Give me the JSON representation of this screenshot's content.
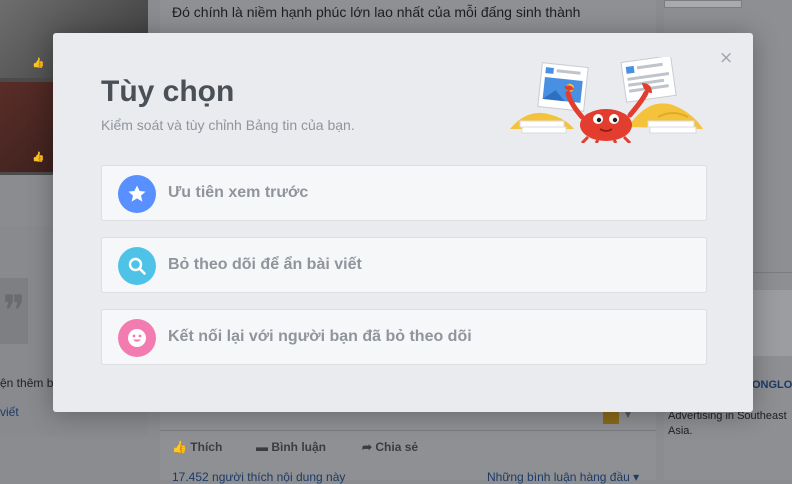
{
  "background": {
    "post_text": "Đó chính là niềm hạnh phúc lớn lao nhất của mỗi đấng sinh thành",
    "left_text_1": "ện thêm bạ",
    "left_text_2": "viết",
    "actions": {
      "like": "Thích",
      "comment": "Bình luận",
      "share": "Chia sẻ"
    },
    "likes_count": "17.452 người thích nội dung này",
    "comments_sort": "Những bình luận hàng đầu ▾",
    "right_heading": "ONGLO",
    "right_text": "e guidelin Mobile Advertising in Southeast Asia."
  },
  "modal": {
    "title": "Tùy chọn",
    "subtitle": "Kiểm soát và tùy chỉnh Bảng tin của bạn.",
    "close_symbol": "×",
    "options": [
      {
        "label": "Ưu tiên xem trước",
        "icon": "star-icon",
        "color": "#5890ff"
      },
      {
        "label": "Bỏ theo dõi để ẩn bài viết",
        "icon": "search-icon",
        "color": "#4fc2e8"
      },
      {
        "label": "Kết nối lại với người bạn đã bỏ theo dõi",
        "icon": "smiley-icon",
        "color": "#f27cb0"
      }
    ]
  }
}
